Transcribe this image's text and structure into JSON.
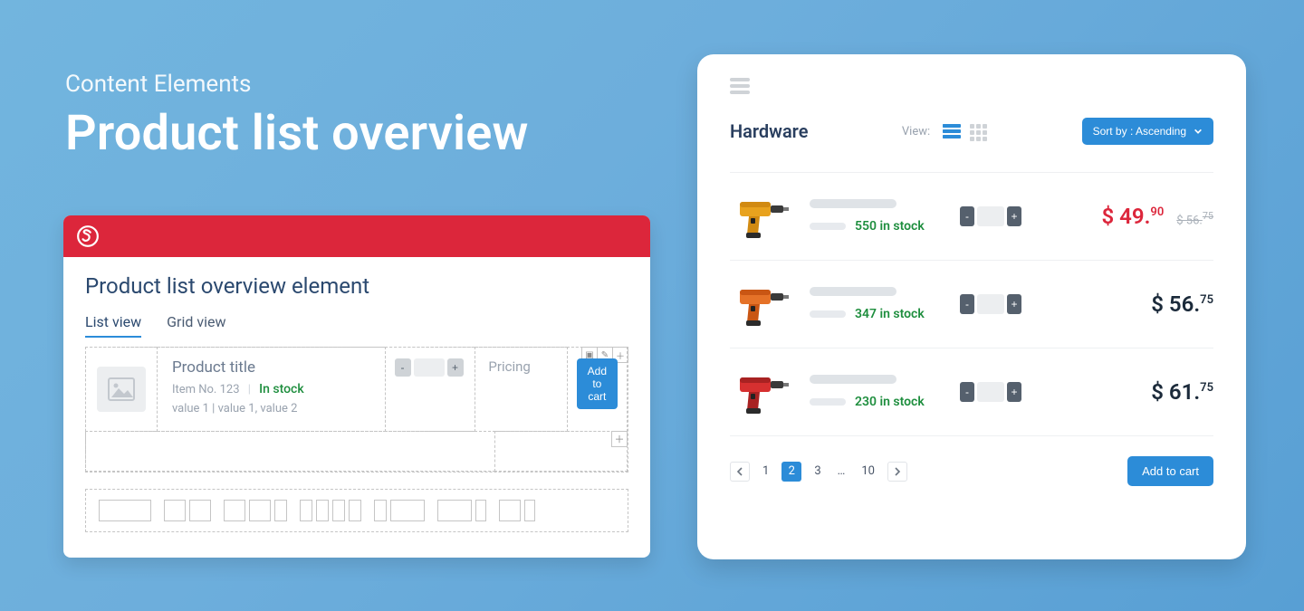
{
  "heading": {
    "kicker": "Content Elements",
    "title": "Product list overview"
  },
  "editor": {
    "title": "Product list overview element",
    "tabs": {
      "list": "List view",
      "grid": "Grid view"
    },
    "row": {
      "product_title": "Product title",
      "item_no": "Item No. 123",
      "stock": "In stock",
      "values": "value 1 | value 1, value 2",
      "pricing": "Pricing",
      "add": "Add to cart"
    }
  },
  "live": {
    "category": "Hardware",
    "view_label": "View:",
    "sort_label": "Sort by : Ascending",
    "products": [
      {
        "stock": "550 in stock",
        "price_whole": "$ 49.",
        "price_cents": "90",
        "old": "$ 56.",
        "old_cents": "75",
        "sale": true,
        "colors": [
          "#e8a21e",
          "#d18a12",
          "#2b2b2b"
        ]
      },
      {
        "stock": "347 in stock",
        "price_whole": "$ 56.",
        "price_cents": "75",
        "old": "",
        "old_cents": "",
        "sale": false,
        "colors": [
          "#e57228",
          "#c95614",
          "#2b2b2b"
        ]
      },
      {
        "stock": "230 in stock",
        "price_whole": "$ 61.",
        "price_cents": "75",
        "old": "",
        "old_cents": "",
        "sale": false,
        "colors": [
          "#d63030",
          "#a82222",
          "#2b2b2b"
        ]
      }
    ],
    "pager": {
      "pages": [
        "1",
        "2",
        "3",
        "…",
        "10"
      ],
      "active": 1
    },
    "add": "Add to cart"
  }
}
